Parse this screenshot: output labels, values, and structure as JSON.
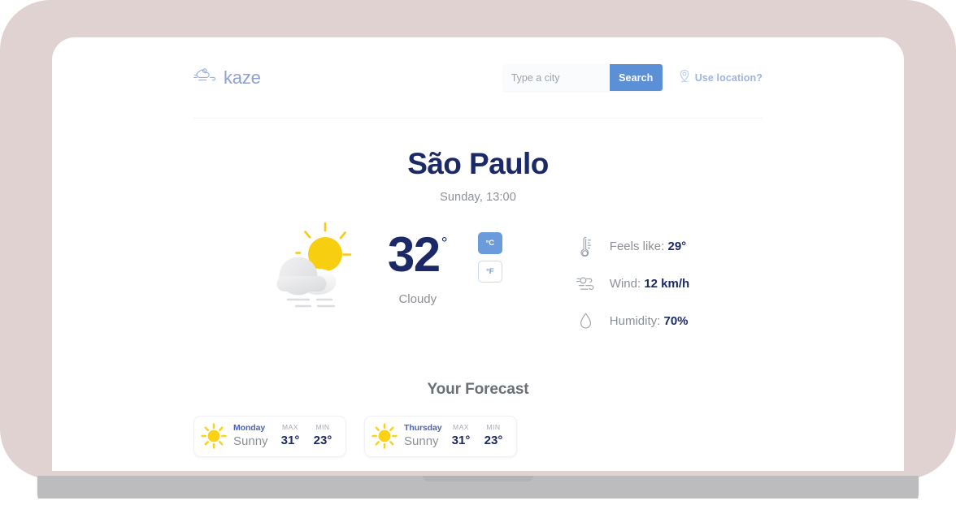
{
  "brand": {
    "name": "kaze",
    "logo_icon": "cloud-wind-icon"
  },
  "search": {
    "placeholder": "Type a city",
    "value": "",
    "button_label": "Search",
    "use_location_label": "Use location?",
    "location_icon": "location-pin-icon"
  },
  "current": {
    "city": "São Paulo",
    "time": "Sunday, 13:00",
    "temperature": "32",
    "degree_symbol": "°",
    "condition": "Cloudy",
    "weather_icon": "sun-behind-cloud-haze-icon",
    "units": [
      {
        "label": "°C",
        "active": true
      },
      {
        "label": "°F",
        "active": false
      }
    ],
    "stats": [
      {
        "icon": "thermometer-icon",
        "label": "Feels like:",
        "value": "29°"
      },
      {
        "icon": "wind-icon",
        "label": "Wind:",
        "value": "12 km/h"
      },
      {
        "icon": "water-drop-icon",
        "label": "Humidity:",
        "value": "70%"
      }
    ]
  },
  "forecast": {
    "title": "Your Forecast",
    "max_label": "MAX",
    "min_label": "MIN",
    "items": [
      {
        "day": "Monday",
        "condition": "Sunny",
        "icon": "sun-icon",
        "max": "31°",
        "min": "23°"
      },
      {
        "day": "Thursday",
        "condition": "Sunny",
        "icon": "sun-icon",
        "max": "31°",
        "min": "23°"
      }
    ]
  },
  "colors": {
    "accent_blue": "#5b8fd6",
    "navy": "#1b2a67",
    "muted_gray": "#8b8f96",
    "sun_yellow": "#fcd116",
    "bezel": "#dfd2d1",
    "laptop_base": "#bcbcbe"
  }
}
